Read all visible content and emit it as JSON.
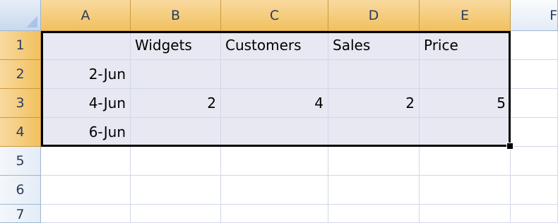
{
  "columns": [
    "A",
    "B",
    "C",
    "D",
    "E",
    "F"
  ],
  "rows": [
    "1",
    "2",
    "3",
    "4",
    "5",
    "6",
    "7"
  ],
  "cells": {
    "r1": [
      "",
      "Widgets",
      "Customers",
      "Sales",
      "Price",
      ""
    ],
    "r2": [
      "2-Jun",
      "",
      "",
      "",
      "",
      ""
    ],
    "r3": [
      "4-Jun",
      "2",
      "4",
      "2",
      "5",
      ""
    ],
    "r4": [
      "6-Jun",
      "",
      "",
      "",
      "",
      ""
    ],
    "r5": [
      "",
      "",
      "",
      "",
      "",
      ""
    ],
    "r6": [
      "",
      "",
      "",
      "",
      "",
      ""
    ],
    "r7": [
      "",
      "",
      "",
      "",
      "",
      ""
    ]
  },
  "selection": {
    "range": "A1:E4"
  },
  "colors": {
    "selected_header": "#f1c15f",
    "header": "#e3ebf6",
    "selection_fill": "#e8e8f3",
    "gridline": "#d0d7e5"
  },
  "icons": {
    "corner": "select-all-icon",
    "fill_handle": "fill-handle-icon"
  }
}
